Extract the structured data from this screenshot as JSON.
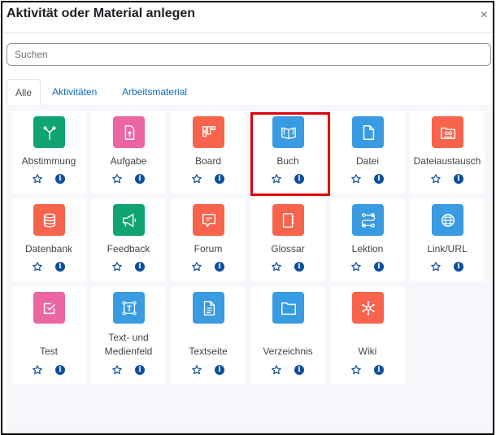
{
  "dialog": {
    "title": "Aktivität oder Material anlegen",
    "close_label": "×",
    "search": {
      "value": "",
      "placeholder": "Suchen"
    },
    "tabs": [
      {
        "label": "Alle",
        "active": true
      },
      {
        "label": "Aktivitäten",
        "active": false
      },
      {
        "label": "Arbeitsmaterial",
        "active": false
      }
    ]
  },
  "colors": {
    "green": "#0fa472",
    "pink": "#eb66a2",
    "red": "#f7634d",
    "blue": "#399be2",
    "link": "#0f6cbf",
    "info": "#0b4e9e",
    "highlight": "#e0000b"
  },
  "modules": [
    {
      "label": "Abstimmung",
      "icon": "choice-icon",
      "color": "#0fa472"
    },
    {
      "label": "Aufgabe",
      "icon": "assignment-upload-icon",
      "color": "#eb66a2"
    },
    {
      "label": "Board",
      "icon": "board-icon",
      "color": "#f7634d"
    },
    {
      "label": "Buch",
      "icon": "book-icon",
      "color": "#399be2",
      "highlighted": true
    },
    {
      "label": "Datei",
      "icon": "file-icon",
      "color": "#399be2"
    },
    {
      "label": "Dateiaustausch",
      "icon": "folder-users-icon",
      "color": "#f7634d"
    },
    {
      "label": "Datenbank",
      "icon": "database-icon",
      "color": "#f7634d"
    },
    {
      "label": "Feedback",
      "icon": "megaphone-icon",
      "color": "#0fa472"
    },
    {
      "label": "Forum",
      "icon": "chat-icon",
      "color": "#f7634d"
    },
    {
      "label": "Glossar",
      "icon": "notebook-icon",
      "color": "#f7634d"
    },
    {
      "label": "Lektion",
      "icon": "path-icon",
      "color": "#399be2"
    },
    {
      "label": "Link/URL",
      "icon": "globe-icon",
      "color": "#399be2"
    },
    {
      "label": "Test",
      "icon": "checkbox-icon",
      "color": "#eb66a2"
    },
    {
      "label": "Text- und Medienfeld",
      "icon": "text-frame-icon",
      "color": "#399be2"
    },
    {
      "label": "Textseite",
      "icon": "page-icon",
      "color": "#399be2"
    },
    {
      "label": "Verzeichnis",
      "icon": "folder-icon",
      "color": "#399be2"
    },
    {
      "label": "Wiki",
      "icon": "network-icon",
      "color": "#f7634d"
    }
  ],
  "tile_actions": {
    "star_icon": "star-outline-icon",
    "info_label": "i"
  }
}
